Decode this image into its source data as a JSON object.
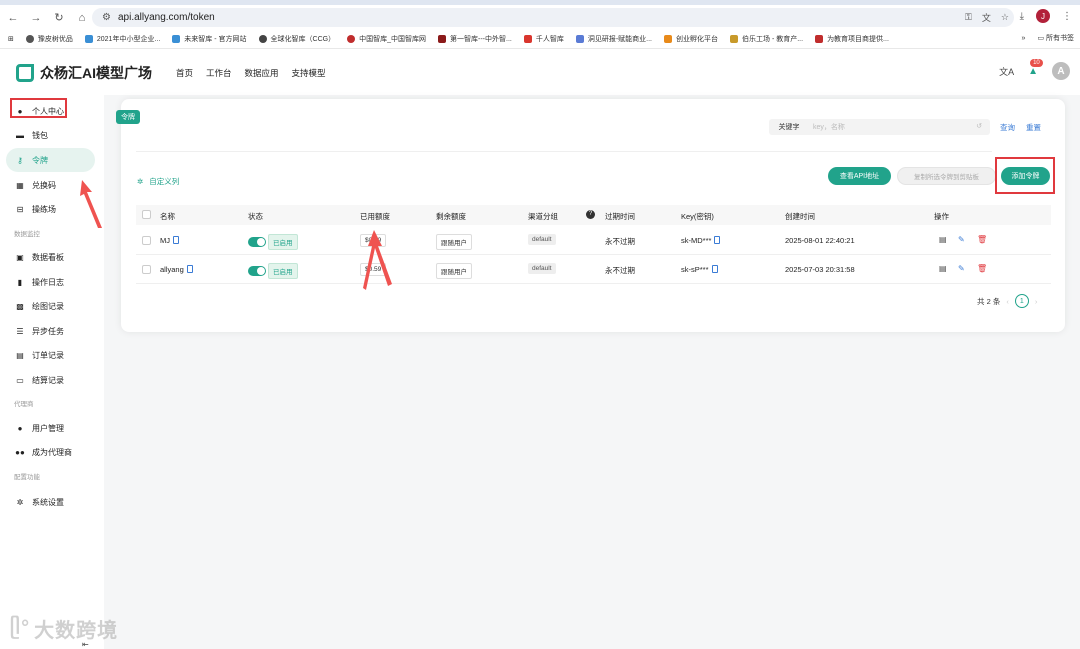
{
  "browser": {
    "url": "api.allyang.com/token",
    "bookmarks": [
      "豫皮树优品",
      "2021年中小型企业...",
      "未来智库 - 官方网站",
      "全球化智库（CCG）",
      "中国智库_中国智库网",
      "第一智库---中外智...",
      "千人智库",
      "洞见研报-赋能商业...",
      "创业孵化平台",
      "伯乐工场 - 教育产...",
      "为教育项目商提供..."
    ],
    "all_bookmarks_label": "所有书签",
    "profile_initial": "J"
  },
  "app": {
    "logo_text": "众杨汇AI模型广场",
    "nav": [
      "首页",
      "工作台",
      "数据应用",
      "支持模型"
    ],
    "notif_count": "10",
    "avatar_initial": "A"
  },
  "sidebar": {
    "personal": "个人中心",
    "wallet": "钱包",
    "token": "令牌",
    "redeem": "兑换码",
    "playground": "操练场",
    "group_monitor": "数据监控",
    "dashboard": "数据看板",
    "oplog": "操作日志",
    "drawlog": "绘图记录",
    "async": "异步任务",
    "orders": "订单记录",
    "settle": "结算记录",
    "group_agent": "代理商",
    "users": "用户管理",
    "become_agent": "成为代理商",
    "group_config": "配置功能",
    "settings": "系统设置"
  },
  "card": {
    "tag": "令牌",
    "keyword_label": "关键字",
    "keyword_placeholder": "key，名称",
    "query": "查询",
    "reset": "重置",
    "custom_cols": "自定义列",
    "view_api": "查看API地址",
    "copy_all": "复制所选令牌到剪贴板",
    "add_token": "添加令牌"
  },
  "table": {
    "headers": [
      "名称",
      "状态",
      "已用额度",
      "剩余额度",
      "渠道分组",
      "过期时间",
      "Key(密钥)",
      "创建时间",
      "操作"
    ],
    "rows": [
      {
        "name": "MJ",
        "status": "已启用",
        "used": "$0.49",
        "remain": "跟随用户",
        "group": "default",
        "expire": "永不过期",
        "key": "sk-MD***",
        "created": "2025-08-01 22:40:21"
      },
      {
        "name": "allyang",
        "status": "已启用",
        "used": "$0.59",
        "remain": "跟随用户",
        "group": "default",
        "expire": "永不过期",
        "key": "sk-sP***",
        "created": "2025-07-03 20:31:58"
      }
    ]
  },
  "pager": {
    "total": "共 2 条",
    "page": "1"
  },
  "watermark": "大数跨境",
  "colors": {
    "accent": "#21a38b",
    "link": "#3a7bd5",
    "highlight": "#e0393e"
  }
}
